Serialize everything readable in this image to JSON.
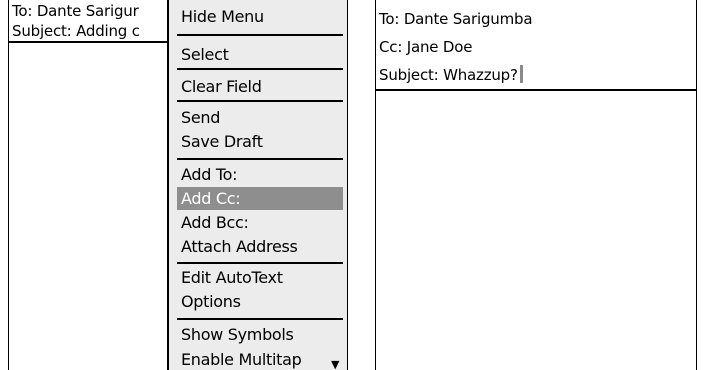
{
  "left_screen": {
    "to_line": "To: Dante Sarigur",
    "subject_line": "Subject: Adding c"
  },
  "menu": {
    "items": [
      {
        "label": "Hide Menu"
      },
      {
        "label": "Select"
      },
      {
        "label": "Clear Field"
      },
      {
        "label": "Send"
      },
      {
        "label": "Save Draft"
      },
      {
        "label": "Add To:"
      },
      {
        "label": "Add Cc:",
        "highlighted": true
      },
      {
        "label": "Add Bcc:"
      },
      {
        "label": "Attach Address"
      },
      {
        "label": "Edit AutoText"
      },
      {
        "label": "Options"
      },
      {
        "label": "Show Symbols"
      },
      {
        "label": "Enable Multitap"
      }
    ],
    "scroll_indicator": "▼",
    "highlight_color": "#8e8e8e"
  },
  "right_screen": {
    "to_line": "To: Dante Sarigumba",
    "cc_line": "Cc: Jane Doe",
    "subject_line": "Subject: Whazzup?"
  }
}
